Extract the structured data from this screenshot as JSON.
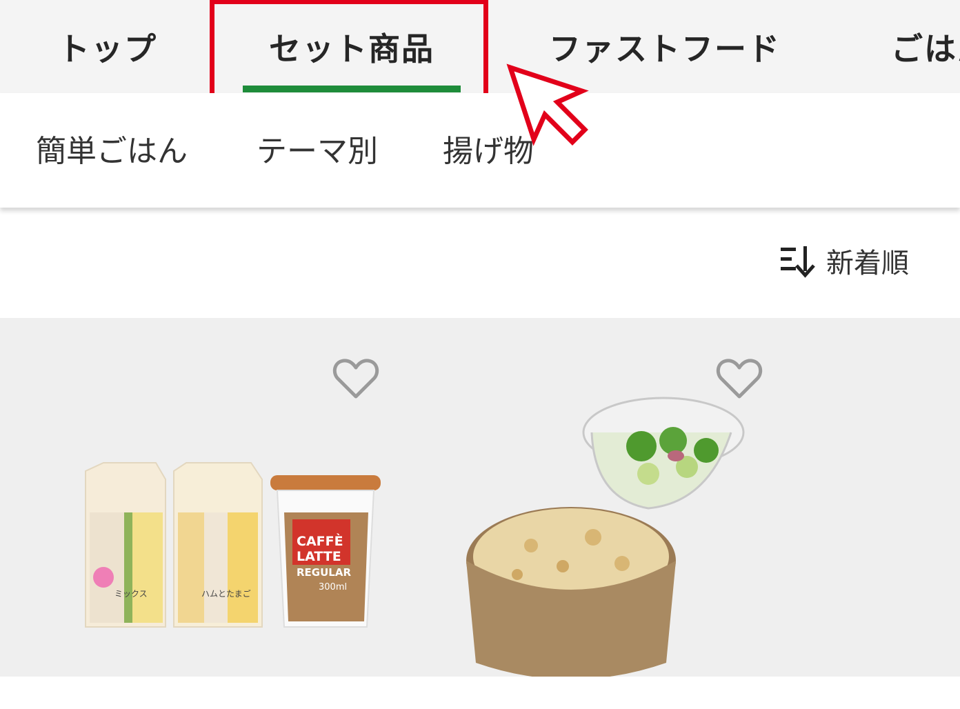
{
  "top_tabs": [
    {
      "label": "トップ"
    },
    {
      "label": "セット商品"
    },
    {
      "label": "ファストフード"
    },
    {
      "label": "ごはん"
    }
  ],
  "active_tab": "セット商品",
  "sub_tabs": [
    {
      "label": "簡単ごはん"
    },
    {
      "label": "テーマ別"
    },
    {
      "label": "揚げ物"
    }
  ],
  "sort": {
    "label": "新着順",
    "icon": "sort-descending-icon"
  },
  "products": [
    {
      "sandwich_1_label": "ミックス",
      "sandwich_2_label": "ハムとたまご",
      "drink_line_1": "CAFFÈ",
      "drink_line_2": "LATTE",
      "drink_line_3": "REGULAR",
      "drink_volume": "300ml",
      "favorite_icon": "heart-outline-icon"
    },
    {
      "favorite_icon": "heart-outline-icon"
    }
  ],
  "colors": {
    "active_underline": "#1e8c3a",
    "highlight_box": "#e2001a",
    "cursor": "#e2001a",
    "tab_bar_bg": "#f4f4f4",
    "product_bg": "#efefef"
  }
}
